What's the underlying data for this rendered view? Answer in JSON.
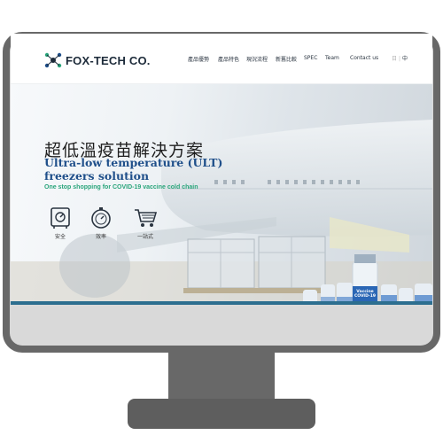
{
  "brand": {
    "name": "FOX-TECH CO."
  },
  "nav": {
    "items": [
      "產品優勢",
      "產品特色",
      "現況流程",
      "新舊比較",
      "SPEC",
      "Team",
      "Contact us"
    ],
    "lang": [
      "日",
      "中"
    ]
  },
  "hero": {
    "title_cn": "超低溫疫苗解決方案",
    "title_en": "Ultra-low temperature (ULT) freezers solution",
    "tagline": "One stop shopping for COVID-19 vaccine cold chain",
    "features": [
      {
        "icon": "safe-icon",
        "label": "安全"
      },
      {
        "icon": "stopwatch-icon",
        "label": "效率"
      },
      {
        "icon": "shopping-cart-icon",
        "label": "一站式"
      }
    ],
    "vial_label": "Vaccine COVID-19"
  },
  "colors": {
    "accent_blue": "#1f4f8a",
    "accent_green": "#2aa57b",
    "frame": "#686868",
    "bottom_bar": "#2c6e8f"
  }
}
